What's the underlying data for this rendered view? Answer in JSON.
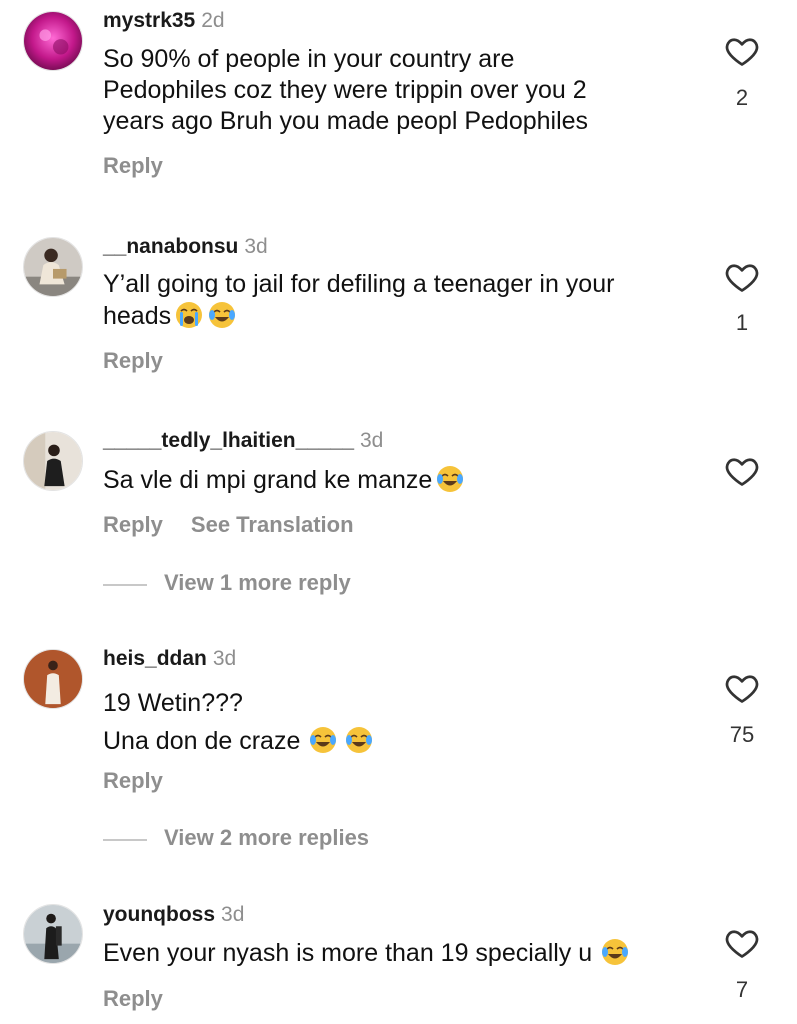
{
  "comments": [
    {
      "username": "mystrk35",
      "time": "2d",
      "text": "So 90% of people in your country are\nPedophiles coz they were trippin over you 2\nyears ago Bruh you made peopl Pedophiles",
      "emojis": [],
      "reply_label": "Reply",
      "like_count": "2",
      "avatar_color": "#c2188a"
    },
    {
      "username": "__nanabonsu",
      "time": "3d",
      "text": "Y’all going to jail for defiling a teenager in your\nheads",
      "emojis": [
        "loudly-crying-face",
        "face-with-tears-of-joy"
      ],
      "reply_label": "Reply",
      "like_count": "1",
      "avatar_color": "#6e6a66"
    },
    {
      "username": "_____tedly_lhaitien_____",
      "time": "3d",
      "text": "Sa vle di mpi grand ke manze",
      "emojis": [
        "face-with-tears-of-joy"
      ],
      "reply_label": "Reply",
      "translation_label": "See Translation",
      "like_count": "",
      "view_replies_label": "View 1 more reply",
      "avatar_color": "#b8aa98"
    },
    {
      "username": "heis_ddan",
      "time": "3d",
      "text": "19 Wetin???\nUna don de craze",
      "emojis": [
        "face-with-tears-of-joy",
        "face-with-tears-of-joy"
      ],
      "reply_label": "Reply",
      "like_count": "75",
      "view_replies_label": "View 2 more replies",
      "avatar_color": "#a04a2a"
    },
    {
      "username": "younqboss",
      "time": "3d",
      "text": "Even your nyash is more than 19 specially u",
      "emojis": [
        "face-with-tears-of-joy"
      ],
      "reply_label": "Reply",
      "like_count": "7",
      "avatar_color": "#9aa6ad"
    }
  ],
  "icons": {
    "like": "heart-outline-icon"
  },
  "colors": {
    "secondary_text": "#8e8e8e",
    "primary_text": "#111111",
    "emoji_yellow": "#f6c33a"
  }
}
